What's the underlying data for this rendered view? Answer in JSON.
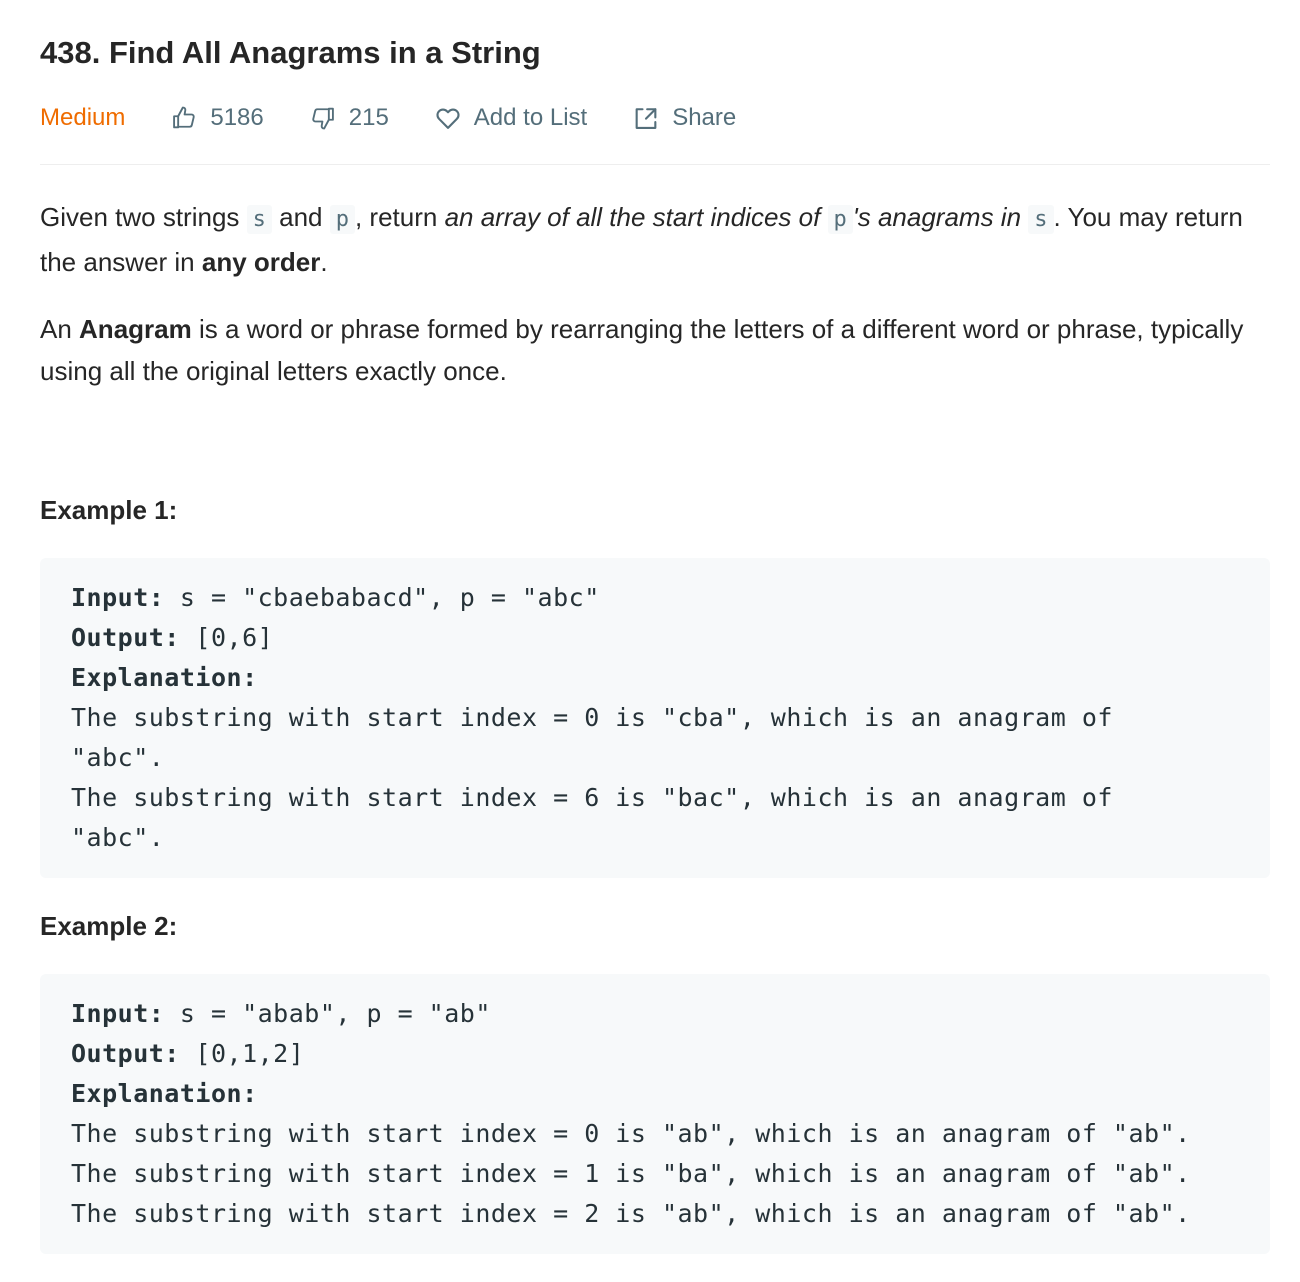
{
  "problem": {
    "title": "438. Find All Anagrams in a String",
    "difficulty": "Medium",
    "likes": "5186",
    "dislikes": "215",
    "add_to_list": "Add to List",
    "share": "Share"
  },
  "icons": {
    "like": "thumbs-up-icon",
    "dislike": "thumbs-down-icon",
    "add_to_list": "heart-icon",
    "share": "share-icon"
  },
  "colors": {
    "difficulty": "#ef6c00",
    "meta_text": "#546e7a",
    "code_bg": "#f7f9fa"
  },
  "description": {
    "p1": {
      "t1": "Given two strings ",
      "c1": "s",
      "t2": " and ",
      "c2": "p",
      "t3": ", return ",
      "i1": "an array of all the start indices of ",
      "c3": "p",
      "i2": "'s anagrams in ",
      "c4": "s",
      "t4": ". You may return the answer in ",
      "b1": "any order",
      "t5": "."
    },
    "p2": {
      "t1": "An ",
      "b1": "Anagram",
      "t2": " is a word or phrase formed by rearranging the letters of a different word or phrase, typically using all the original letters exactly once."
    }
  },
  "examples": [
    {
      "title": "Example 1:",
      "input_label": "Input:",
      "input": " s = \"cbaebabacd\", p = \"abc\"",
      "output_label": "Output:",
      "output": " [0,6]",
      "explanation_label": "Explanation:",
      "explanation": "The substring with start index = 0 is \"cba\", which is an anagram of\n\"abc\".\nThe substring with start index = 6 is \"bac\", which is an anagram of\n\"abc\"."
    },
    {
      "title": "Example 2:",
      "input_label": "Input:",
      "input": " s = \"abab\", p = \"ab\"",
      "output_label": "Output:",
      "output": " [0,1,2]",
      "explanation_label": "Explanation:",
      "explanation": "The substring with start index = 0 is \"ab\", which is an anagram of \"ab\".\nThe substring with start index = 1 is \"ba\", which is an anagram of \"ab\".\nThe substring with start index = 2 is \"ab\", which is an anagram of \"ab\"."
    }
  ]
}
